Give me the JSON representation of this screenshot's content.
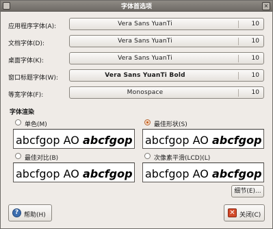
{
  "window": {
    "title": "字体首选项"
  },
  "fonts": [
    {
      "label": "应用程序字体(A):",
      "font": "Vera Sans YuanTi",
      "size": "10"
    },
    {
      "label": "文档字体(D):",
      "font": "Vera Sans YuanTi",
      "size": "10"
    },
    {
      "label": "桌面字体(K):",
      "font": "Vera Sans YuanTi",
      "size": "10"
    },
    {
      "label": "窗口标题字体(W):",
      "font": "Vera Sans YuanTi Bold",
      "size": "10"
    },
    {
      "label": "等宽字体(F):",
      "font": "Monospace",
      "size": "10"
    }
  ],
  "rendering": {
    "title": "字体渲染",
    "options": [
      {
        "label": "单色(M)",
        "selected": false,
        "sample": "abcfgop AO",
        "sample_italic": "abcfgop"
      },
      {
        "label": "最佳形状(S)",
        "selected": true,
        "sample": "abcfgop AO",
        "sample_italic": "abcfgop"
      },
      {
        "label": "最佳对比(B)",
        "selected": false,
        "sample": "abcfgop AO",
        "sample_italic": "abcfgop"
      },
      {
        "label": "次像素平滑(LCD)(L)",
        "selected": false,
        "sample": "abcfgop AO",
        "sample_italic": "abcfgop"
      }
    ]
  },
  "buttons": {
    "details": "细节(E)...",
    "help": "帮助(H)",
    "close": "关闭(C)"
  },
  "icons": {
    "help": "help-icon",
    "close": "close-icon",
    "help_glyph": "?",
    "close_glyph": "✕"
  },
  "colors": {
    "titlebar": "#7d7974",
    "window_bg": "#efebe7",
    "radio_selected": "#c45a1a"
  }
}
